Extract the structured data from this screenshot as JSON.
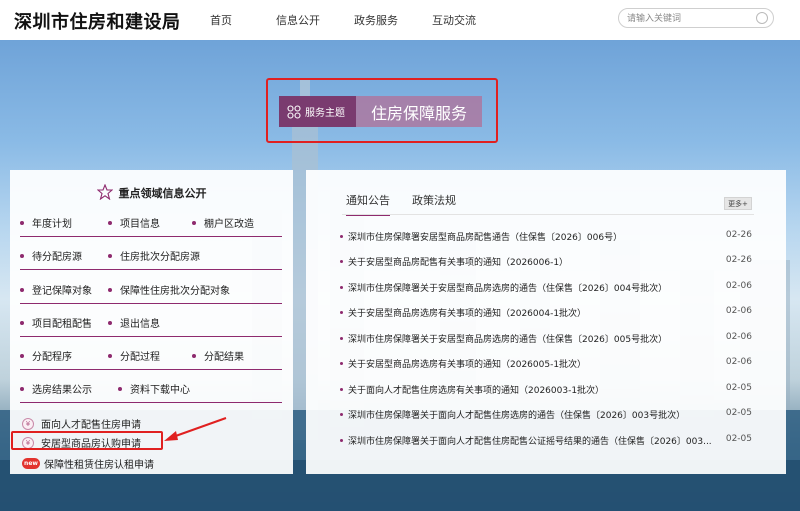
{
  "header": {
    "logo": "深圳市住房和建设局",
    "nav": [
      {
        "label": "首页"
      },
      {
        "label": "信息公开"
      },
      {
        "label": "政务服务"
      },
      {
        "label": "互动交流"
      }
    ],
    "search_placeholder": "请输入关键词"
  },
  "theme": {
    "badge_label": "服务主题",
    "title": "住房保障服务"
  },
  "left_panel": {
    "title": "重点领域信息公开",
    "rows": [
      [
        "年度计划",
        "项目信息",
        "棚户区改造"
      ],
      [
        "待分配房源",
        "住房批次分配房源"
      ],
      [
        "登记保障对象",
        "保障性住房批次分配对象"
      ],
      [
        "项目配租配售",
        "退出信息"
      ],
      [
        "分配程序",
        "分配过程",
        "分配结果"
      ],
      [
        "选房结果公示",
        "资料下载中心"
      ]
    ],
    "applications": [
      {
        "label": "面向人才配售住房申请",
        "badge": ""
      },
      {
        "label": "安居型商品房认购申请",
        "badge": ""
      },
      {
        "label": "保障性租赁住房认租申请",
        "badge": "new"
      }
    ]
  },
  "right_panel": {
    "tabs": [
      {
        "label": "通知公告"
      },
      {
        "label": "政策法规"
      }
    ],
    "more_label": "更多+",
    "notices": [
      {
        "title": "深圳市住房保障署安居型商品房配售通告（住保售〔2026〕006号）",
        "date": "02-26"
      },
      {
        "title": "关于安居型商品房配售有关事项的通知（2026006-1）",
        "date": "02-26"
      },
      {
        "title": "深圳市住房保障署关于安居型商品房选房的通告（住保售〔2026〕004号批次）",
        "date": "02-06"
      },
      {
        "title": "关于安居型商品房选房有关事项的通知（2026004-1批次）",
        "date": "02-06"
      },
      {
        "title": "深圳市住房保障署关于安居型商品房选房的通告（住保售〔2026〕005号批次）",
        "date": "02-06"
      },
      {
        "title": "关于安居型商品房选房有关事项的通知（2026005-1批次）",
        "date": "02-06"
      },
      {
        "title": "关于面向人才配售住房选房有关事项的通知（2026003-1批次）",
        "date": "02-05"
      },
      {
        "title": "深圳市住房保障署关于面向人才配售住房选房的通告（住保售〔2026〕003号批次）",
        "date": "02-05"
      },
      {
        "title": "深圳市住房保障署关于面向人才配售住房配售公证摇号结果的通告（住保售〔2026〕003...",
        "date": "02-05"
      }
    ]
  },
  "colors": {
    "accent": "#8e2a6e",
    "highlight": "#e02020",
    "theme_badge": "#7a3b6f"
  }
}
